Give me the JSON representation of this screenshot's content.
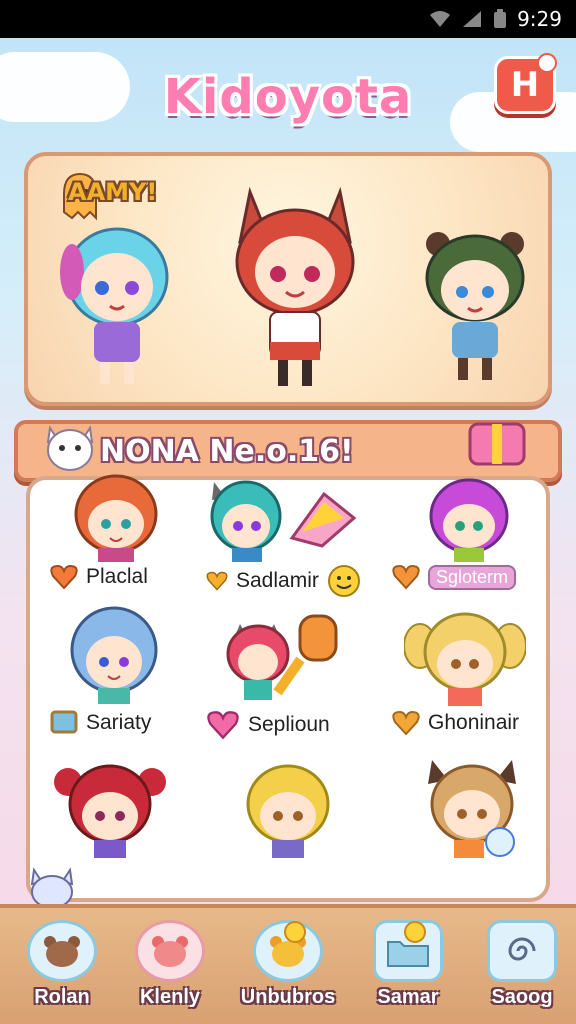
{
  "status_bar": {
    "time": "9:29"
  },
  "header": {
    "logo_text": "Kidoyota",
    "logo_button_label": "H"
  },
  "hero": {
    "badge_text": "AAMY!"
  },
  "list": {
    "title": "NONA Ne.o.16!",
    "cells": [
      {
        "label": "Placlal",
        "icon": "heart-icon",
        "color": "#f47a3a"
      },
      {
        "label": "Sadlamir",
        "icon": "heart-icon",
        "color": "#f4b02a"
      },
      {
        "label": "Sgloterm",
        "icon": "heart-icon",
        "color": "#f4943a"
      },
      {
        "label": "Sariaty",
        "icon": "tablet-icon",
        "color": "#7ec0e0"
      },
      {
        "label": "Seplioun",
        "icon": "heart-icon",
        "color": "#f36aa8"
      },
      {
        "label": "Ghoninair",
        "icon": "heart-icon",
        "color": "#f4a63a"
      }
    ]
  },
  "bottom_nav": [
    {
      "label": "Rolan",
      "icon": "bear-icon"
    },
    {
      "label": "Klenly",
      "icon": "bear-icon"
    },
    {
      "label": "Unbubros",
      "icon": "bear-icon"
    },
    {
      "label": "Samar",
      "icon": "folder-icon"
    },
    {
      "label": "Saoog",
      "icon": "spiral-icon"
    }
  ]
}
